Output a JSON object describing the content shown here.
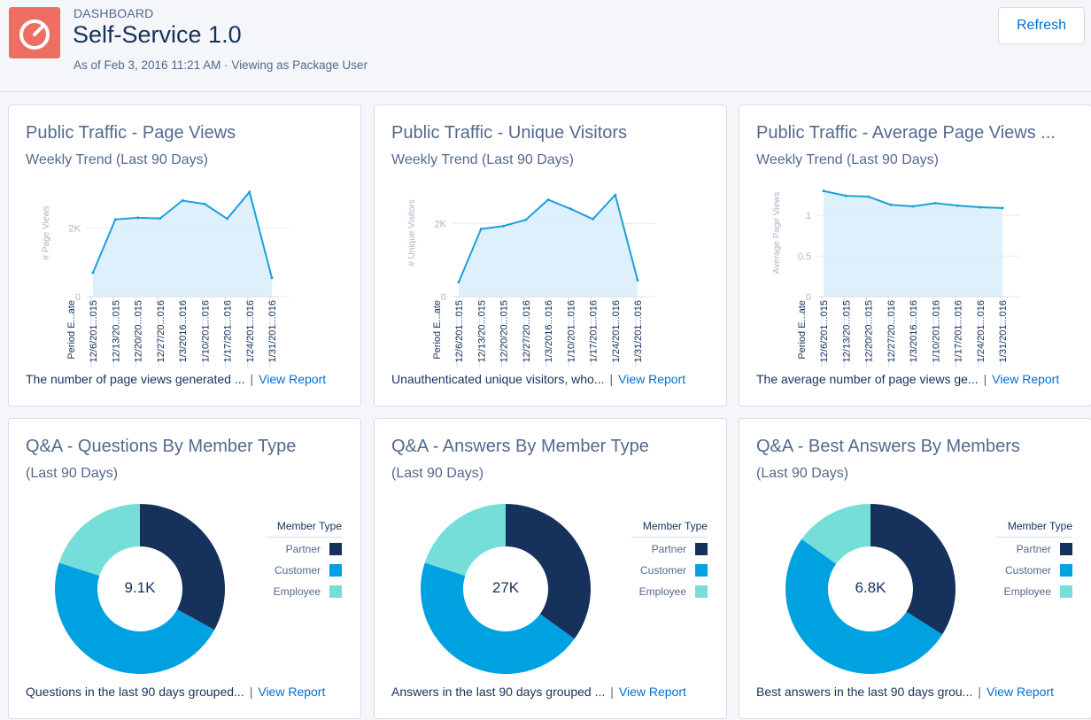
{
  "header": {
    "eyebrow": "DASHBOARD",
    "title": "Self-Service 1.0",
    "subtitle": "As of Feb 3, 2016 11:21 AM · Viewing as Package User",
    "refresh_label": "Refresh",
    "icon": "dashboard-gauge-icon"
  },
  "colors": {
    "partner": "#16325c",
    "customer": "#00a1e0",
    "employee": "#76ded9",
    "line": "#1ba1d9",
    "area": "#d8edfa",
    "link": "#0070d2",
    "app_icon": "#ef6e64"
  },
  "cards": [
    {
      "title": "Public Traffic - Page Views",
      "subtitle": "Weekly Trend (Last 90 Days)",
      "footer_text": "The number of page views generated ...",
      "footer_sep": "|",
      "link": "View Report"
    },
    {
      "title": "Public Traffic - Unique Visitors",
      "subtitle": "Weekly Trend (Last 90 Days)",
      "footer_text": "Unauthenticated unique visitors, who...",
      "footer_sep": "|",
      "link": "View Report"
    },
    {
      "title": "Public Traffic - Average Page Views ...",
      "subtitle": "Weekly Trend (Last 90 Days)",
      "footer_text": "The average number of page views ge...",
      "footer_sep": "|",
      "link": "View Report"
    },
    {
      "title": "Q&A - Questions By Member Type",
      "subtitle": "(Last 90 Days)",
      "footer_text": "Questions in the last 90 days grouped...",
      "footer_sep": "|",
      "link": "View Report"
    },
    {
      "title": "Q&A - Answers By Member Type",
      "subtitle": "(Last 90 Days)",
      "footer_text": "Answers in the last 90 days grouped ...",
      "footer_sep": "|",
      "link": "View Report"
    },
    {
      "title": "Q&A - Best Answers By Members",
      "subtitle": "(Last 90 Days)",
      "footer_text": "Best answers in the last 90 days grou...",
      "footer_sep": "|",
      "link": "View Report"
    }
  ],
  "chart_data": [
    {
      "type": "area",
      "ylabel": "# Page Views",
      "xlabel": "Period E...ate",
      "categories": [
        "12/6/201...015",
        "12/13/20...015",
        "12/20/20...015",
        "12/27/20...016",
        "1/3/2016...016",
        "1/10/201...016",
        "1/17/201...016",
        "1/24/201...016",
        "1/31/201...016"
      ],
      "x": [
        0,
        1,
        2,
        3,
        4,
        5,
        6,
        7,
        8,
        9,
        10,
        11,
        12
      ],
      "values": [
        700,
        2250,
        2300,
        2280,
        2800,
        2700,
        2270,
        3050,
        550
      ],
      "yticks": [
        "0",
        "2K"
      ],
      "ylim": [
        0,
        3200
      ],
      "grid": true
    },
    {
      "type": "area",
      "ylabel": "# Unique Visitors",
      "xlabel": "Period E...ate",
      "categories": [
        "12/6/201...015",
        "12/13/20...015",
        "12/20/20...015",
        "12/27/20...016",
        "1/3/2016...016",
        "1/10/201...016",
        "1/17/201...016",
        "1/24/201...016",
        "1/31/201...016"
      ],
      "values": [
        400,
        1850,
        1930,
        2100,
        2650,
        2400,
        2120,
        2780,
        450
      ],
      "yticks": [
        "0",
        "2K"
      ],
      "ylim": [
        0,
        3000
      ],
      "grid": true
    },
    {
      "type": "area",
      "ylabel": "Average Page Views",
      "xlabel": "Period E...ate",
      "categories": [
        "12/6/201...015",
        "12/13/20...015",
        "12/20/20...015",
        "12/27/20...016",
        "1/3/2016...016",
        "1/10/201...016",
        "1/17/201...016",
        "1/24/201...016",
        "1/31/201...016"
      ],
      "values": [
        1.3,
        1.24,
        1.23,
        1.13,
        1.11,
        1.15,
        1.12,
        1.1,
        1.09
      ],
      "yticks": [
        "0",
        "0.5",
        "1"
      ],
      "ylim": [
        0,
        1.35
      ],
      "grid": true
    },
    {
      "type": "pie",
      "center_label": "9.1K",
      "legend_title": "Member Type",
      "categories": [
        "Partner",
        "Customer",
        "Employee"
      ],
      "values": [
        33,
        47,
        20
      ]
    },
    {
      "type": "pie",
      "center_label": "27K",
      "legend_title": "Member Type",
      "categories": [
        "Partner",
        "Customer",
        "Employee"
      ],
      "values": [
        35,
        45,
        20
      ]
    },
    {
      "type": "pie",
      "center_label": "6.8K",
      "legend_title": "Member Type",
      "categories": [
        "Partner",
        "Customer",
        "Employee"
      ],
      "values": [
        34,
        51,
        15
      ]
    }
  ]
}
